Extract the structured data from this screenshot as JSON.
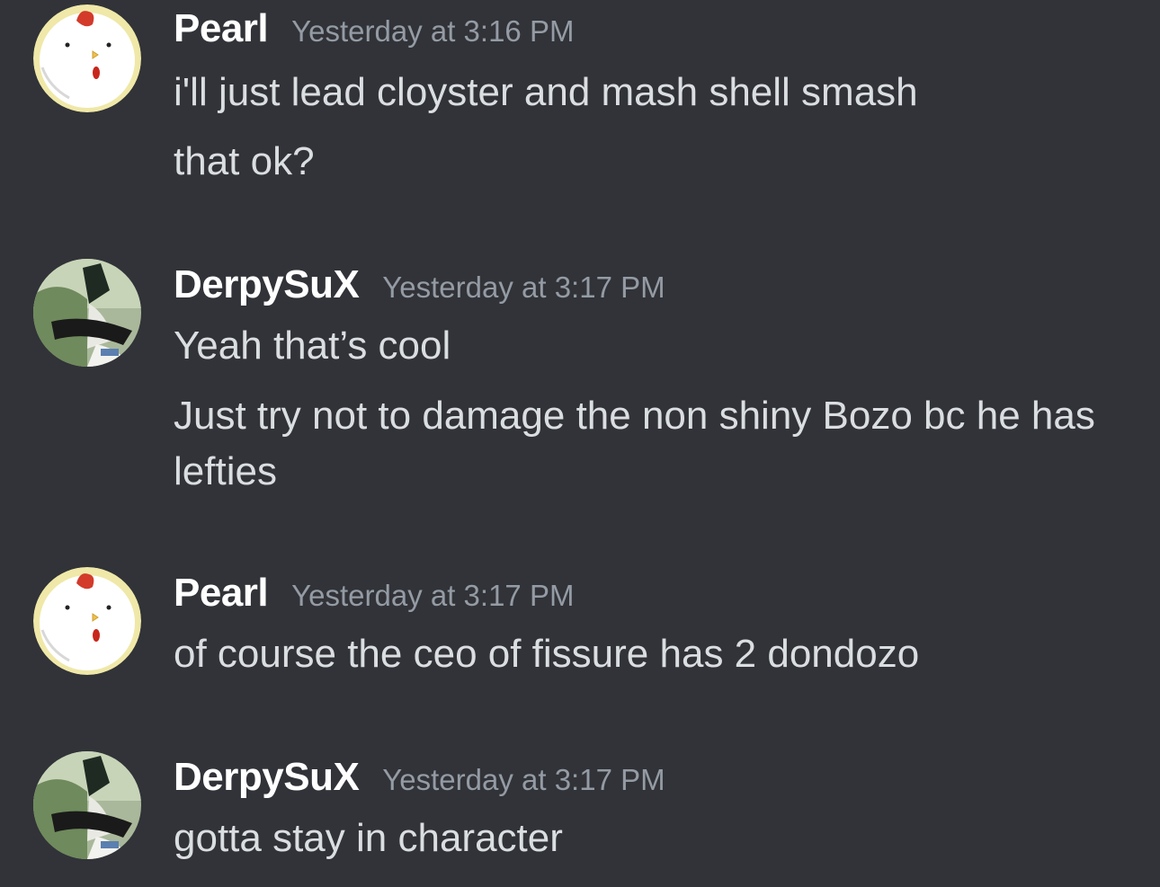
{
  "messages": [
    {
      "author": "Pearl",
      "avatar_icon": "chicken-avatar-icon",
      "timestamp": "Yesterday at 3:16 PM",
      "lines": [
        "i'll just lead cloyster and mash shell smash",
        "that ok?"
      ]
    },
    {
      "author": "DerpySuX",
      "avatar_icon": "meowscarada-avatar-icon",
      "timestamp": "Yesterday at 3:17 PM",
      "lines": [
        "Yeah that’s cool",
        "Just try not to damage the non shiny Bozo bc he has lefties"
      ]
    },
    {
      "author": "Pearl",
      "avatar_icon": "chicken-avatar-icon",
      "timestamp": "Yesterday at 3:17 PM",
      "lines": [
        "of course the ceo of fissure has 2 dondozo"
      ]
    },
    {
      "author": "DerpySuX",
      "avatar_icon": "meowscarada-avatar-icon",
      "timestamp": "Yesterday at 3:17 PM",
      "lines": [
        "gotta stay in character"
      ]
    }
  ],
  "colors": {
    "background": "#313338",
    "username": "#ffffff",
    "timestamp": "#949ba4",
    "message_text": "#dbdee1"
  }
}
